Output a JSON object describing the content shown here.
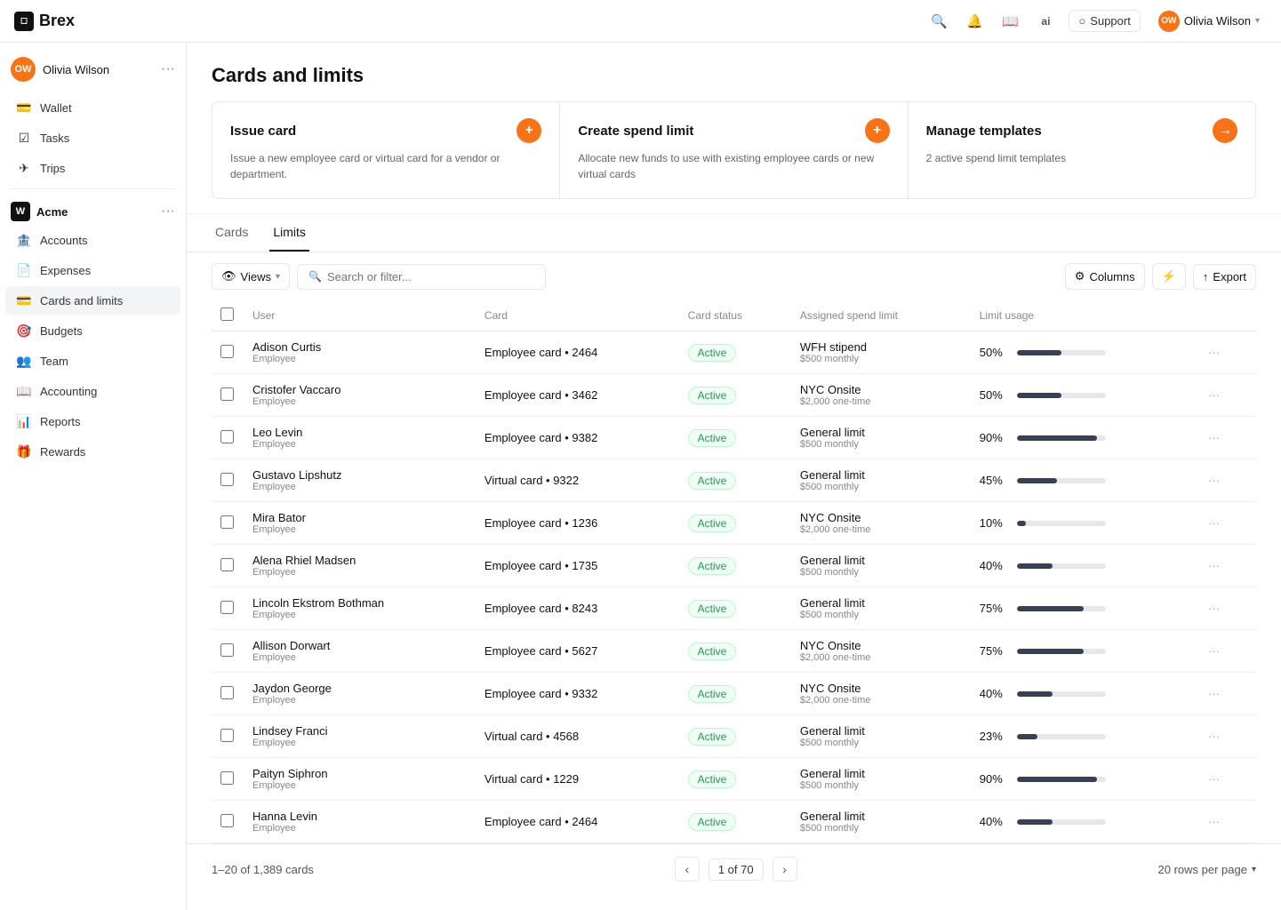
{
  "brand": {
    "name": "Brex",
    "icon_text": "B"
  },
  "topnav": {
    "icons": [
      "search",
      "bell",
      "book",
      "ai"
    ],
    "support_label": "Support",
    "user_name": "Olivia Wilson",
    "user_initials": "OW"
  },
  "sidebar": {
    "user_name": "Olivia Wilson",
    "user_initials": "OW",
    "personal_items": [
      {
        "id": "wallet",
        "label": "Wallet",
        "icon": "💳"
      },
      {
        "id": "tasks",
        "label": "Tasks",
        "icon": "✅"
      },
      {
        "id": "trips",
        "label": "Trips",
        "icon": "✈️"
      }
    ],
    "org_name": "Acme",
    "org_items": [
      {
        "id": "accounts",
        "label": "Accounts",
        "icon": "🏦"
      },
      {
        "id": "expenses",
        "label": "Expenses",
        "icon": "📄"
      },
      {
        "id": "cards",
        "label": "Cards and limits",
        "icon": "💳",
        "active": true
      },
      {
        "id": "budgets",
        "label": "Budgets",
        "icon": "🎯"
      },
      {
        "id": "team",
        "label": "Team",
        "icon": "👥"
      },
      {
        "id": "accounting",
        "label": "Accounting",
        "icon": "📖"
      },
      {
        "id": "reports",
        "label": "Reports",
        "icon": "📊"
      },
      {
        "id": "rewards",
        "label": "Rewards",
        "icon": "🎁"
      }
    ]
  },
  "page": {
    "title": "Cards and limits",
    "action_cards": [
      {
        "id": "issue-card",
        "title": "Issue card",
        "description": "Issue a new employee card or virtual card for a vendor or department.",
        "btn_type": "plus",
        "btn_icon": "+"
      },
      {
        "id": "create-spend-limit",
        "title": "Create spend limit",
        "description": "Allocate new funds to use with existing employee cards or new virtual cards",
        "btn_type": "plus",
        "btn_icon": "+"
      },
      {
        "id": "manage-templates",
        "title": "Manage templates",
        "description": "2 active spend limit templates",
        "btn_type": "arrow",
        "btn_icon": "→"
      }
    ],
    "tabs": [
      {
        "id": "cards",
        "label": "Cards"
      },
      {
        "id": "limits",
        "label": "Limits",
        "active": true
      }
    ],
    "toolbar": {
      "views_label": "Views",
      "search_placeholder": "Search or filter...",
      "columns_label": "Columns",
      "export_label": "Export"
    },
    "table": {
      "columns": [
        "User",
        "Card",
        "Card status",
        "Assigned spend limit",
        "Limit usage"
      ],
      "rows": [
        {
          "name": "Adison Curtis",
          "role": "Employee",
          "card": "Employee card • 2464",
          "status": "Active",
          "limit_name": "WFH stipend",
          "limit_sub": "$500 monthly",
          "usage_pct": 50,
          "usage_label": "50%"
        },
        {
          "name": "Cristofer Vaccaro",
          "role": "Employee",
          "card": "Employee card • 3462",
          "status": "Active",
          "limit_name": "NYC Onsite",
          "limit_sub": "$2,000 one-time",
          "usage_pct": 50,
          "usage_label": "50%"
        },
        {
          "name": "Leo Levin",
          "role": "Employee",
          "card": "Employee card • 9382",
          "status": "Active",
          "limit_name": "General limit",
          "limit_sub": "$500 monthly",
          "usage_pct": 90,
          "usage_label": "90%"
        },
        {
          "name": "Gustavo Lipshutz",
          "role": "Employee",
          "card": "Virtual card • 9322",
          "status": "Active",
          "limit_name": "General limit",
          "limit_sub": "$500 monthly",
          "usage_pct": 45,
          "usage_label": "45%"
        },
        {
          "name": "Mira Bator",
          "role": "Employee",
          "card": "Employee card • 1236",
          "status": "Active",
          "limit_name": "NYC Onsite",
          "limit_sub": "$2,000 one-time",
          "usage_pct": 10,
          "usage_label": "10%"
        },
        {
          "name": "Alena Rhiel Madsen",
          "role": "Employee",
          "card": "Employee card • 1735",
          "status": "Active",
          "limit_name": "General limit",
          "limit_sub": "$500 monthly",
          "usage_pct": 40,
          "usage_label": "40%"
        },
        {
          "name": "Lincoln Ekstrom Bothman",
          "role": "Employee",
          "card": "Employee card • 8243",
          "status": "Active",
          "limit_name": "General limit",
          "limit_sub": "$500 monthly",
          "usage_pct": 75,
          "usage_label": "75%"
        },
        {
          "name": "Allison Dorwart",
          "role": "Employee",
          "card": "Employee card • 5627",
          "status": "Active",
          "limit_name": "NYC Onsite",
          "limit_sub": "$2,000 one-time",
          "usage_pct": 75,
          "usage_label": "75%"
        },
        {
          "name": "Jaydon George",
          "role": "Employee",
          "card": "Employee card • 9332",
          "status": "Active",
          "limit_name": "NYC Onsite",
          "limit_sub": "$2,000 one-time",
          "usage_pct": 40,
          "usage_label": "40%"
        },
        {
          "name": "Lindsey Franci",
          "role": "Employee",
          "card": "Virtual card • 4568",
          "status": "Active",
          "limit_name": "General limit",
          "limit_sub": "$500 monthly",
          "usage_pct": 23,
          "usage_label": "23%"
        },
        {
          "name": "Paityn Siphron",
          "role": "Employee",
          "card": "Virtual card • 1229",
          "status": "Active",
          "limit_name": "General limit",
          "limit_sub": "$500 monthly",
          "usage_pct": 90,
          "usage_label": "90%"
        },
        {
          "name": "Hanna Levin",
          "role": "Employee",
          "card": "Employee card • 2464",
          "status": "Active",
          "limit_name": "General limit",
          "limit_sub": "$500 monthly",
          "usage_pct": 40,
          "usage_label": "40%"
        }
      ]
    },
    "pagination": {
      "range_label": "1–20 of 1,389 cards",
      "page_info": "1 of 70",
      "rows_per_page": "20 rows per page"
    }
  }
}
